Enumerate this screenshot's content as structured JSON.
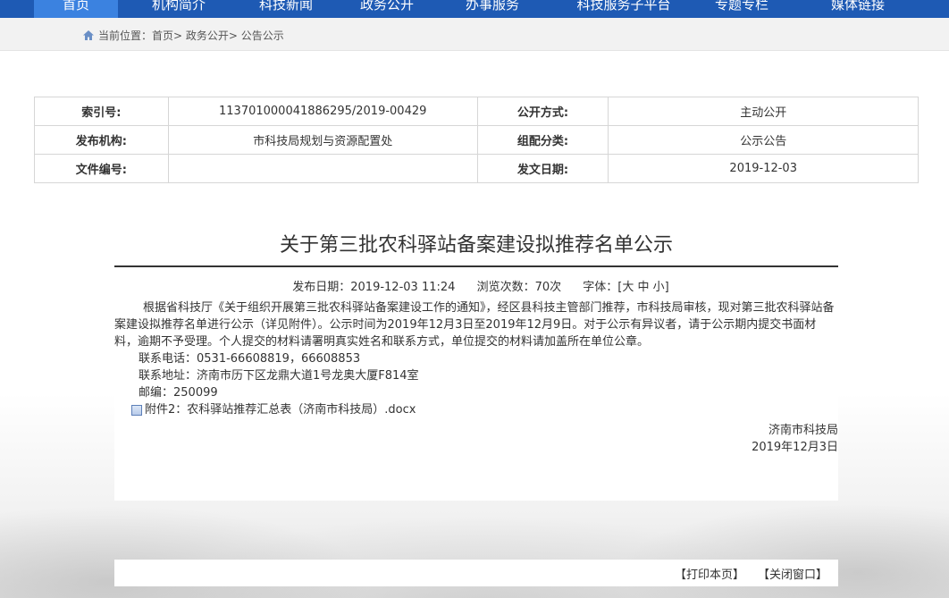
{
  "nav": {
    "items": [
      "首页",
      "机构简介",
      "科技新闻",
      "政务公开",
      "办事服务",
      "科技服务子平台",
      "专题专栏",
      "媒体链接"
    ],
    "active_index": 0,
    "color": "#1e5ab4"
  },
  "breadcrumb": {
    "text": "当前位置：首页> 政务公开> 公告公示"
  },
  "meta": {
    "index_label": "索引号:",
    "index_value": "113701000041886295/2019-00429",
    "public_label": "公开方式:",
    "public_value": "主动公开",
    "org_label": "发布机构:",
    "org_value": "市科技局规划与资源配置处",
    "category_label": "组配分类:",
    "category_value": "公示公告",
    "docno_label": "文件编号:",
    "docno_value": "",
    "date_label": "发文日期:",
    "date_value": "2019-12-03"
  },
  "article": {
    "title": "关于第三批农科驿站备案建设拟推荐名单公示",
    "publish": "发布日期：2019-12-03 11:24",
    "views": "浏览次数：70次",
    "font_label": "字体：[",
    "font_large": "大",
    "font_medium": "中",
    "font_small": "小",
    "font_end": "]",
    "paragraph": "根据省科技厅《关于组织开展第三批农科驿站备案建设工作的通知》，经区县科技主管部门推荐，市科技局审核，现对第三批农科驿站备案建设拟推荐名单进行公示（详见附件）。公示时间为2019年12月3日至2019年12月9日。对于公示有异议者，请于公示期内提交书面材料，逾期不予受理。个人提交的材料请署明真实姓名和联系方式，单位提交的材料请加盖所在单位公章。",
    "phone": "联系电话：0531-66608819，66608853",
    "address": "联系地址：济南市历下区龙鼎大道1号龙奥大厦F814室",
    "postcode": "邮编：250099",
    "attachment": "附件2：农科驿站推荐汇总表（济南市科技局）.docx",
    "sign_org": "济南市科技局",
    "sign_date": "2019年12月3日"
  },
  "footer": {
    "print": "【打印本页】",
    "close": "【关闭窗口】"
  }
}
